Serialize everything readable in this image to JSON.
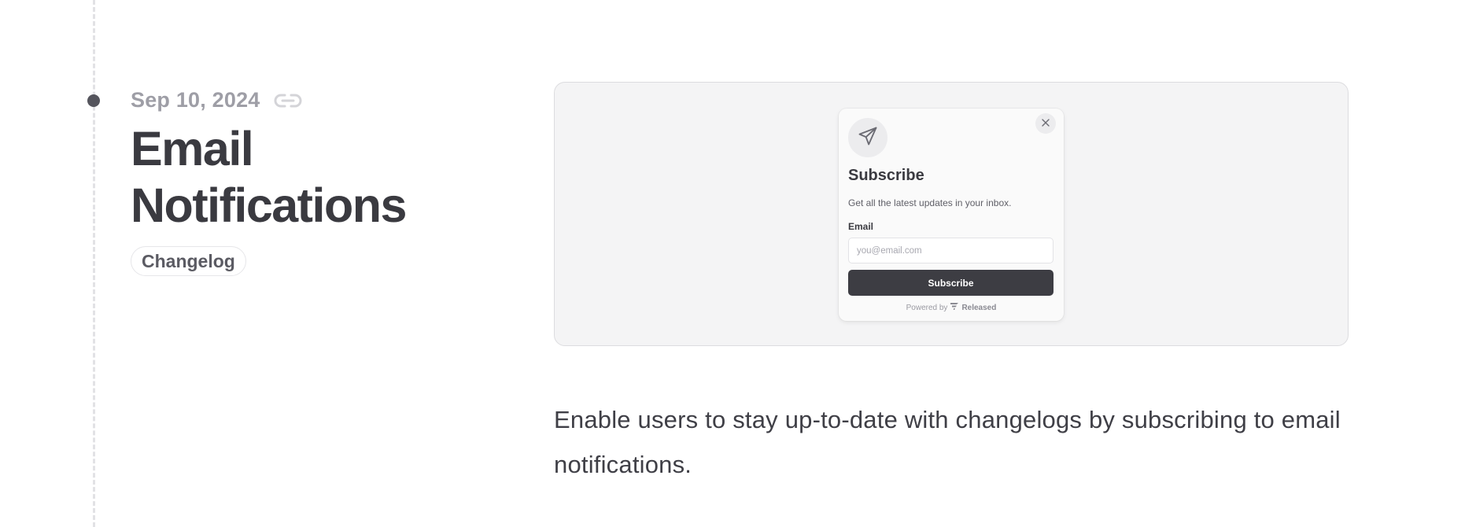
{
  "entry": {
    "date": "Sep 10, 2024",
    "title": "Email Notifications",
    "tag": "Changelog",
    "description": "Enable users to stay up-to-date with changelogs by subscribing to email notifications."
  },
  "icons": {
    "timeline": "timeline-dot",
    "permalink": "link-icon",
    "modal": "paper-plane-icon",
    "close": "close-icon",
    "brand": "released-logo-icon"
  },
  "preview": {
    "modal": {
      "title": "Subscribe",
      "description": "Get all the latest updates in your inbox.",
      "email_label": "Email",
      "email_placeholder": "you@email.com",
      "email_value": "",
      "button_label": "Subscribe",
      "powered_by": "Powered by",
      "brand": "Released"
    }
  },
  "colors": {
    "title": "#3a3a40",
    "date": "#9e9ea6",
    "button": "#3d3d43",
    "preview_bg": "#f4f4f5"
  }
}
